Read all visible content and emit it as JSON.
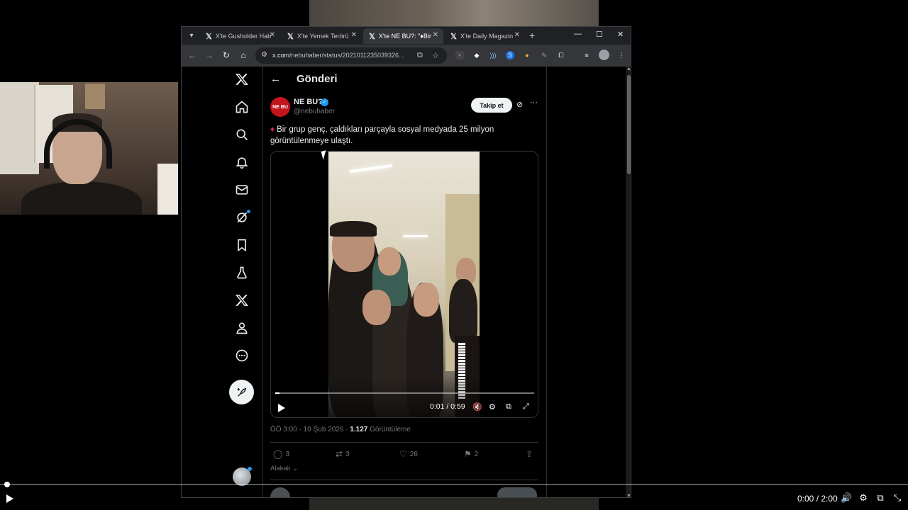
{
  "player": {
    "time": "0:00 / 2:00",
    "progress": 0.005
  },
  "browser": {
    "tabs": [
      {
        "title": "X'te Gusholder Hab"
      },
      {
        "title": "X'te Yemek Terörü"
      },
      {
        "title": "X'te NE BU?: \"♦Bir"
      },
      {
        "title": "X'te Daily Magazin"
      }
    ],
    "active_tab": 2,
    "url_host": "x.com",
    "url_path": "/nebuhaber/status/202101123503932​6..."
  },
  "x": {
    "page_title": "Gönderi",
    "author": {
      "name": "NE BU?",
      "handle": "@nebuhaber",
      "avatar_text": "NE BU"
    },
    "follow_label": "Takip et",
    "tweet_text": "Bir grup genç, çaldıkları parçayla sosyal medyada 25 milyon görüntülenmeye ulaştı.",
    "video": {
      "time": "0:01 / 0:59",
      "progress": 0.017
    },
    "meta_time": "ÖÖ 3:00 · 10 Şub 2026 · ",
    "views_count": "1.127",
    "views_label": " Görüntüleme",
    "actions": {
      "replies": "3",
      "reposts": "3",
      "likes": "26",
      "bookmarks": "2"
    },
    "related_label": "Alakalı"
  }
}
